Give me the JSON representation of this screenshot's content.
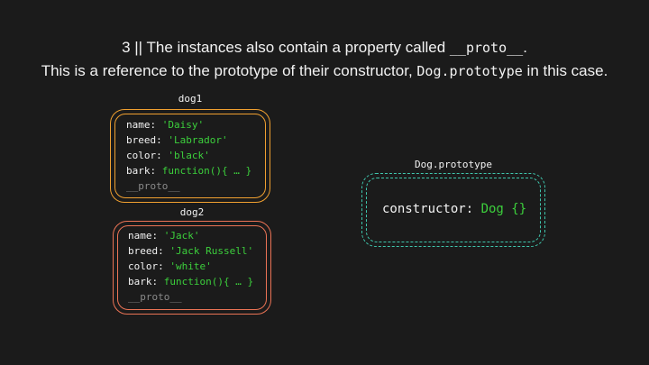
{
  "heading": {
    "line1_prefix": "3 || The instances also contain a property called ",
    "line1_code": "__proto__",
    "line1_suffix": ".",
    "line2_prefix": "This is a reference to the prototype of their constructor, ",
    "line2_code": "Dog.prototype",
    "line2_suffix": " in this case."
  },
  "dog1": {
    "label": "dog1",
    "color": "#f0a030",
    "props": [
      {
        "key": "name: ",
        "value": "'Daisy'"
      },
      {
        "key": "breed: ",
        "value": "'Labrador'"
      },
      {
        "key": "color: ",
        "value": "'black'"
      },
      {
        "key": "bark: ",
        "value": "function(){ … }"
      }
    ],
    "proto": "__proto__"
  },
  "dog2": {
    "label": "dog2",
    "color": "#ea7355",
    "props": [
      {
        "key": "name: ",
        "value": "'Jack'"
      },
      {
        "key": "breed: ",
        "value": "'Jack Russell'"
      },
      {
        "key": "color: ",
        "value": "'white'"
      },
      {
        "key": "bark: ",
        "value": "function(){ … }"
      }
    ],
    "proto": "__proto__"
  },
  "prototype": {
    "label": "Dog.prototype",
    "color": "#3fc6ad",
    "key": "constructor: ",
    "value": "Dog {}"
  },
  "colors": {
    "background": "#1b1b1b",
    "string_value": "#3ccf3c",
    "proto_text": "#8a8a8a"
  }
}
